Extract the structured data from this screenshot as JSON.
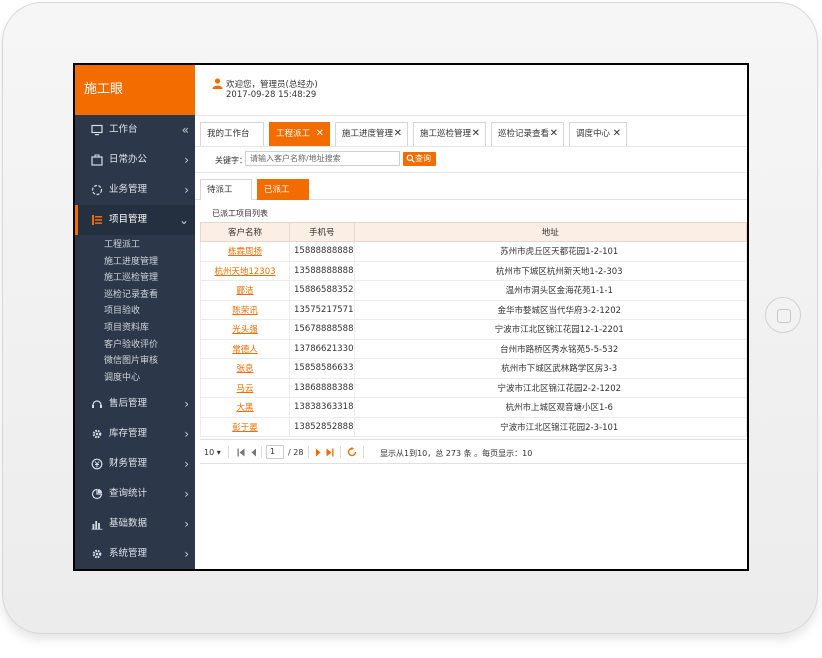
{
  "app": {
    "title": "施工眼"
  },
  "header": {
    "welcome": "欢迎您，管理员(总经办)",
    "datetime": "2017-09-28 15:48:29"
  },
  "sidebar": {
    "workbench": "工作台",
    "collapse": "«",
    "items": [
      {
        "label": "日常办公",
        "icon": "briefcase-icon"
      },
      {
        "label": "业务管理",
        "icon": "circle-icon"
      },
      {
        "label": "项目管理",
        "icon": "list-icon"
      },
      {
        "label": "售后管理",
        "icon": "headset-icon"
      },
      {
        "label": "库存管理",
        "icon": "gear-icon"
      },
      {
        "label": "财务管理",
        "icon": "money-icon"
      },
      {
        "label": "查询统计",
        "icon": "pie-icon"
      },
      {
        "label": "基础数据",
        "icon": "bar-chart-icon"
      },
      {
        "label": "系统管理",
        "icon": "gear-icon"
      }
    ],
    "subitems": [
      "工程派工",
      "施工进度管理",
      "施工巡检管理",
      "巡检记录查看",
      "项目验收",
      "项目资料库",
      "客户验收评价",
      "微信图片审核",
      "调度中心"
    ]
  },
  "tabs": [
    {
      "label": "我的工作台",
      "close": ""
    },
    {
      "label": "工程派工",
      "close": "✕"
    },
    {
      "label": "施工进度管理",
      "close": "✕"
    },
    {
      "label": "施工巡检管理",
      "close": "✕"
    },
    {
      "label": "巡检记录查看",
      "close": "✕"
    },
    {
      "label": "调度中心",
      "close": "✕"
    }
  ],
  "search": {
    "label": "关键字：",
    "placeholder": "请输入客户名称/地址搜索",
    "button": "查询"
  },
  "subtabs": [
    "待派工",
    "已派工"
  ],
  "table": {
    "title": "已派工项目列表",
    "headers": [
      "客户名称",
      "手机号",
      "地址"
    ],
    "rows": [
      [
        "栋霖周扬",
        "15888888888",
        "苏州市虎丘区天都花园1-2-101"
      ],
      [
        "杭州天地12303",
        "13588888888",
        "杭州市下城区杭州新天地1-2-303"
      ],
      [
        "郦洁",
        "15886588352",
        "温州市洞头区金海花苑1-1-1"
      ],
      [
        "陈荣讯",
        "13575217571",
        "金华市婺城区当代华府3-2-1202"
      ],
      [
        "光头强",
        "15678888588",
        "宁波市江北区锦江花园12-1-2201"
      ],
      [
        "常德人",
        "13786621330",
        "台州市路桥区秀水铭苑5-5-532"
      ],
      [
        "张息",
        "15858586633",
        "杭州市下城区武林路学区房3-3"
      ],
      [
        "马云",
        "13868888388",
        "宁波市江北区锦江花园2-2-1202"
      ],
      [
        "大黑",
        "13838363318",
        "杭州市上城区观音塘小区1-6"
      ],
      [
        "彭于晏",
        "13852852888",
        "宁波市江北区锦江花园2-3-101"
      ]
    ]
  },
  "pager": {
    "size": "10 ▾",
    "page": "1",
    "total": "/ 28",
    "info": "显示从1到10，总 273 条 。每页显示：10"
  },
  "colors": {
    "accent": "#f36c00",
    "sidebar": "#2c3849",
    "header_row": "#fbeee4"
  }
}
